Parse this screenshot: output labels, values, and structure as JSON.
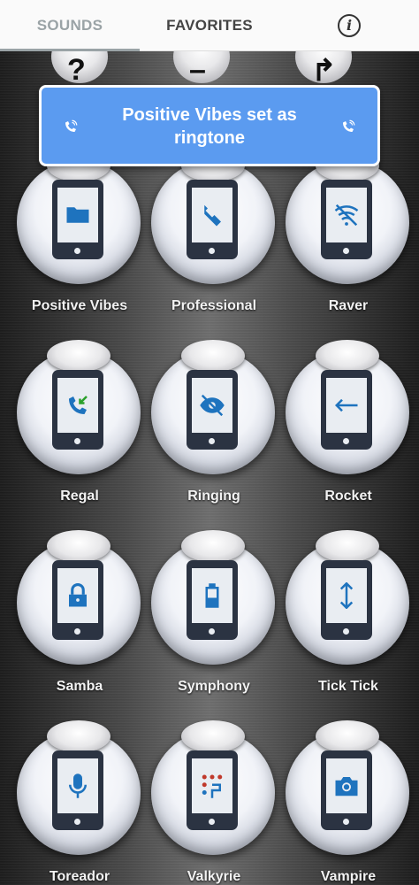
{
  "tabs": {
    "sounds": "SOUNDS",
    "favorites": "FAVORITES",
    "info": "i"
  },
  "toast": {
    "message": "Positive Vibes set as ringtone",
    "icon": "phone-ringing-icon"
  },
  "colors": {
    "accent": "#5b9bf0",
    "glyph": "#1e73be",
    "phone": "#2b3342"
  },
  "sounds": [
    {
      "label": "Positive Vibes",
      "icon": "folder-icon"
    },
    {
      "label": "Professional",
      "icon": "hand-pointer-icon"
    },
    {
      "label": "Raver",
      "icon": "wifi-off-icon"
    },
    {
      "label": "Regal",
      "icon": "incoming-call-icon"
    },
    {
      "label": "Ringing",
      "icon": "eye-off-icon"
    },
    {
      "label": "Rocket",
      "icon": "arrow-left-icon"
    },
    {
      "label": "Samba",
      "icon": "lock-icon"
    },
    {
      "label": "Symphony",
      "icon": "battery-icon"
    },
    {
      "label": "Tick Tick",
      "icon": "vertical-arrows-icon"
    },
    {
      "label": "Toreador",
      "icon": "microphone-icon"
    },
    {
      "label": "Valkyrie",
      "icon": "dialpad-icon"
    },
    {
      "label": "Vampire",
      "icon": "camera-icon"
    }
  ]
}
